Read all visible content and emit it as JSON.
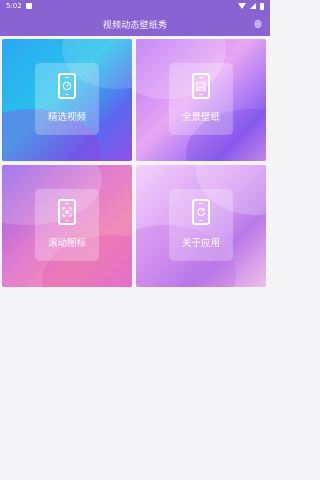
{
  "status_bar": {
    "time": "5:02"
  },
  "app_bar": {
    "title": "视频动态壁纸秀",
    "settings_icon": "gear-icon"
  },
  "tiles": [
    {
      "label": "精选视频",
      "icon": "speedometer-phone-icon"
    },
    {
      "label": "全景壁纸",
      "icon": "image-phone-icon"
    },
    {
      "label": "滚动图标",
      "icon": "scan-phone-icon"
    },
    {
      "label": "关于应用",
      "icon": "refresh-phone-icon"
    }
  ],
  "colors": {
    "primary": "#8a63d2",
    "background": "#f4f4f6"
  }
}
